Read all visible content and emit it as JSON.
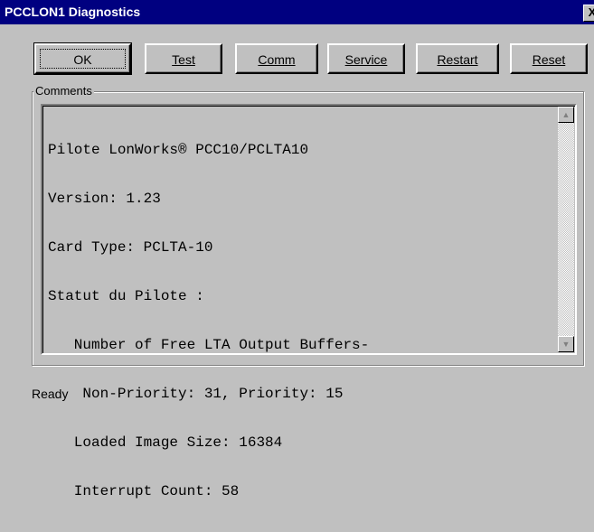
{
  "window": {
    "title": "PCCLON1 Diagnostics",
    "close_label": "X"
  },
  "buttons": {
    "ok": "OK",
    "test": "Test",
    "comm": "Comm",
    "service": "Service",
    "restart": "Restart",
    "reset": "Reset"
  },
  "comments": {
    "label": "Comments",
    "lines": [
      "Pilote LonWorks® PCC10/PCLTA10",
      "Version: 1.23",
      "Card Type: PCLTA-10",
      "Statut du Pilote :",
      "   Number of Free LTA Output Buffers-",
      "    Non-Priority: 31, Priority: 15",
      "   Loaded Image Size: 16384",
      "   Interrupt Count: 58"
    ]
  },
  "status": {
    "text": "Ready"
  }
}
